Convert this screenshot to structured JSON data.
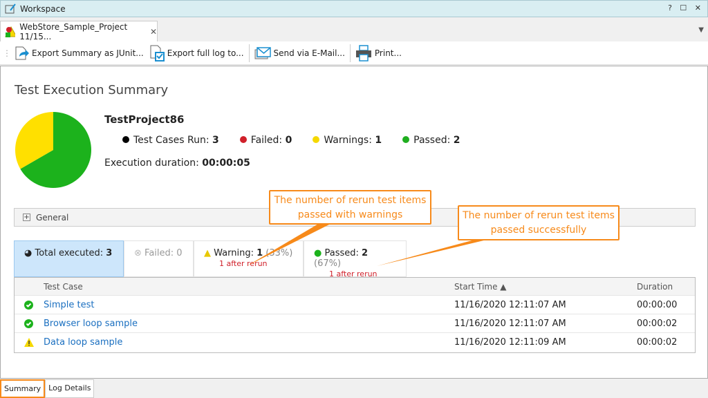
{
  "window": {
    "title": "Workspace",
    "controls": "? ☐ ✕"
  },
  "doc_tab": {
    "label": "WebStore_Sample_Project 11/15...",
    "close": "✕"
  },
  "toolbar": {
    "export_junit": "Export Summary as JUnit...",
    "export_log": "Export full log to...",
    "send_email": "Send via E-Mail...",
    "print": "Print..."
  },
  "summary": {
    "heading": "Test Execution Summary",
    "project": "TestProject86",
    "stats": [
      {
        "label": "Test Cases Run:",
        "value": "3",
        "color": "#000000"
      },
      {
        "label": "Failed:",
        "value": "0",
        "color": "#d0202a"
      },
      {
        "label": "Warnings:",
        "value": "1",
        "color": "#f5d800"
      },
      {
        "label": "Passed:",
        "value": "2",
        "color": "#1fae1f"
      }
    ],
    "duration_label": "Execution duration:",
    "duration_value": "00:00:05",
    "pie": {
      "warning": 1,
      "passed": 2,
      "colors": {
        "warning": "#ffe000",
        "passed": "#1cb21c"
      }
    }
  },
  "general": {
    "label": "General"
  },
  "filter_tabs": {
    "total": {
      "label": "Total executed:",
      "value": "3"
    },
    "failed": {
      "label": "Failed: 0"
    },
    "warning": {
      "label": "Warning:",
      "value": "1",
      "pct": "(33%)",
      "sub": "1 after rerun"
    },
    "passed": {
      "label": "Passed:",
      "value": "2",
      "pct": "(67%)",
      "sub": "1 after rerun"
    }
  },
  "grid": {
    "columns": [
      "Test Case",
      "Start Time ▲",
      "Duration"
    ],
    "rows": [
      {
        "status": "passed",
        "name": "Simple test",
        "start": "11/16/2020 12:11:07 AM",
        "duration": "00:00:00"
      },
      {
        "status": "passed",
        "name": "Browser loop sample",
        "start": "11/16/2020 12:11:07 AM",
        "duration": "00:00:02"
      },
      {
        "status": "warning",
        "name": "Data loop sample",
        "start": "11/16/2020 12:11:09 AM",
        "duration": "00:00:02"
      }
    ]
  },
  "callouts": {
    "warnings": "The number of rerun test items passed with warnings",
    "passed": "The number of rerun test items passed successfully"
  },
  "bottom_tabs": [
    "Summary",
    "Log Details"
  ]
}
